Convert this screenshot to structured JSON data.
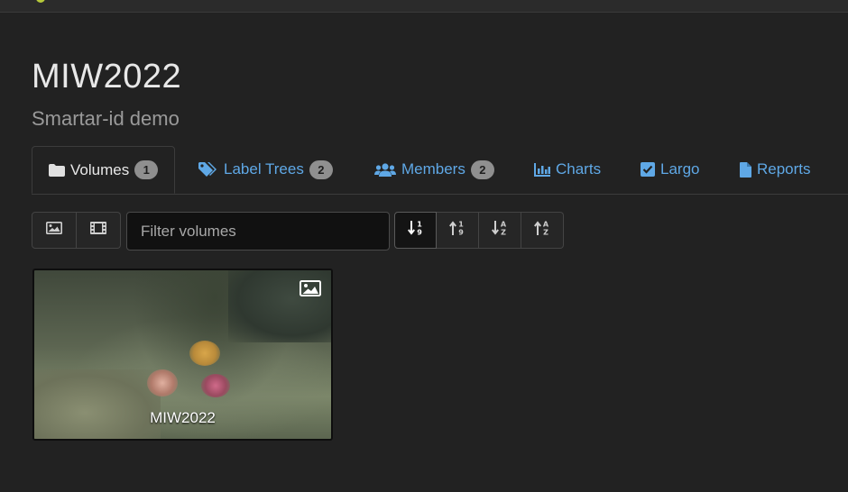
{
  "project": {
    "title": "MIW2022",
    "subtitle": "Smartar-id demo"
  },
  "tabs": [
    {
      "label": "Volumes",
      "count": "1",
      "icon": "folder-icon",
      "active": true
    },
    {
      "label": "Label Trees",
      "count": "2",
      "icon": "tags-icon",
      "active": false
    },
    {
      "label": "Members",
      "count": "2",
      "icon": "users-icon",
      "active": false
    },
    {
      "label": "Charts",
      "icon": "chart-icon",
      "active": false
    },
    {
      "label": "Largo",
      "icon": "check-square-icon",
      "active": false
    },
    {
      "label": "Reports",
      "icon": "file-icon",
      "active": false
    }
  ],
  "toolbar": {
    "media_filters": [
      {
        "icon": "image-icon"
      },
      {
        "icon": "film-icon"
      }
    ],
    "filter_placeholder": "Filter volumes",
    "filter_value": "",
    "sort_buttons": [
      {
        "icon": "sort-numeric-down-icon",
        "active": true
      },
      {
        "icon": "sort-numeric-up-icon",
        "active": false
      },
      {
        "icon": "sort-alpha-down-icon",
        "active": false
      },
      {
        "icon": "sort-alpha-up-icon",
        "active": false
      }
    ]
  },
  "volumes": [
    {
      "name": "MIW2022",
      "type_icon": "image-icon"
    }
  ],
  "colors": {
    "background": "#222222",
    "link": "#5fa8e6",
    "badge": "#8f8f8f"
  }
}
